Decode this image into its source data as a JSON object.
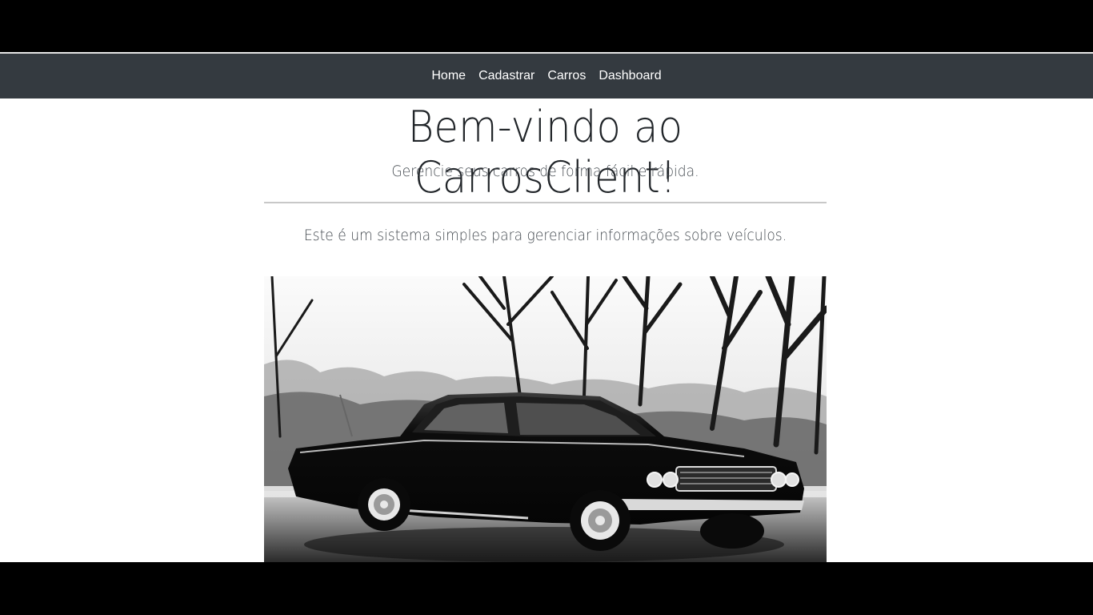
{
  "nav": {
    "links": [
      "Home",
      "Cadastrar",
      "Carros",
      "Dashboard"
    ]
  },
  "hero": {
    "title": "Bem-vindo ao CarrosClient!",
    "lead": "Gerencie seus carros de forma fácil e rápida.",
    "description": "Este é um sistema simples para gerenciar informações sobre veículos."
  },
  "image": {
    "subject": "black-and-white classic car photo"
  }
}
